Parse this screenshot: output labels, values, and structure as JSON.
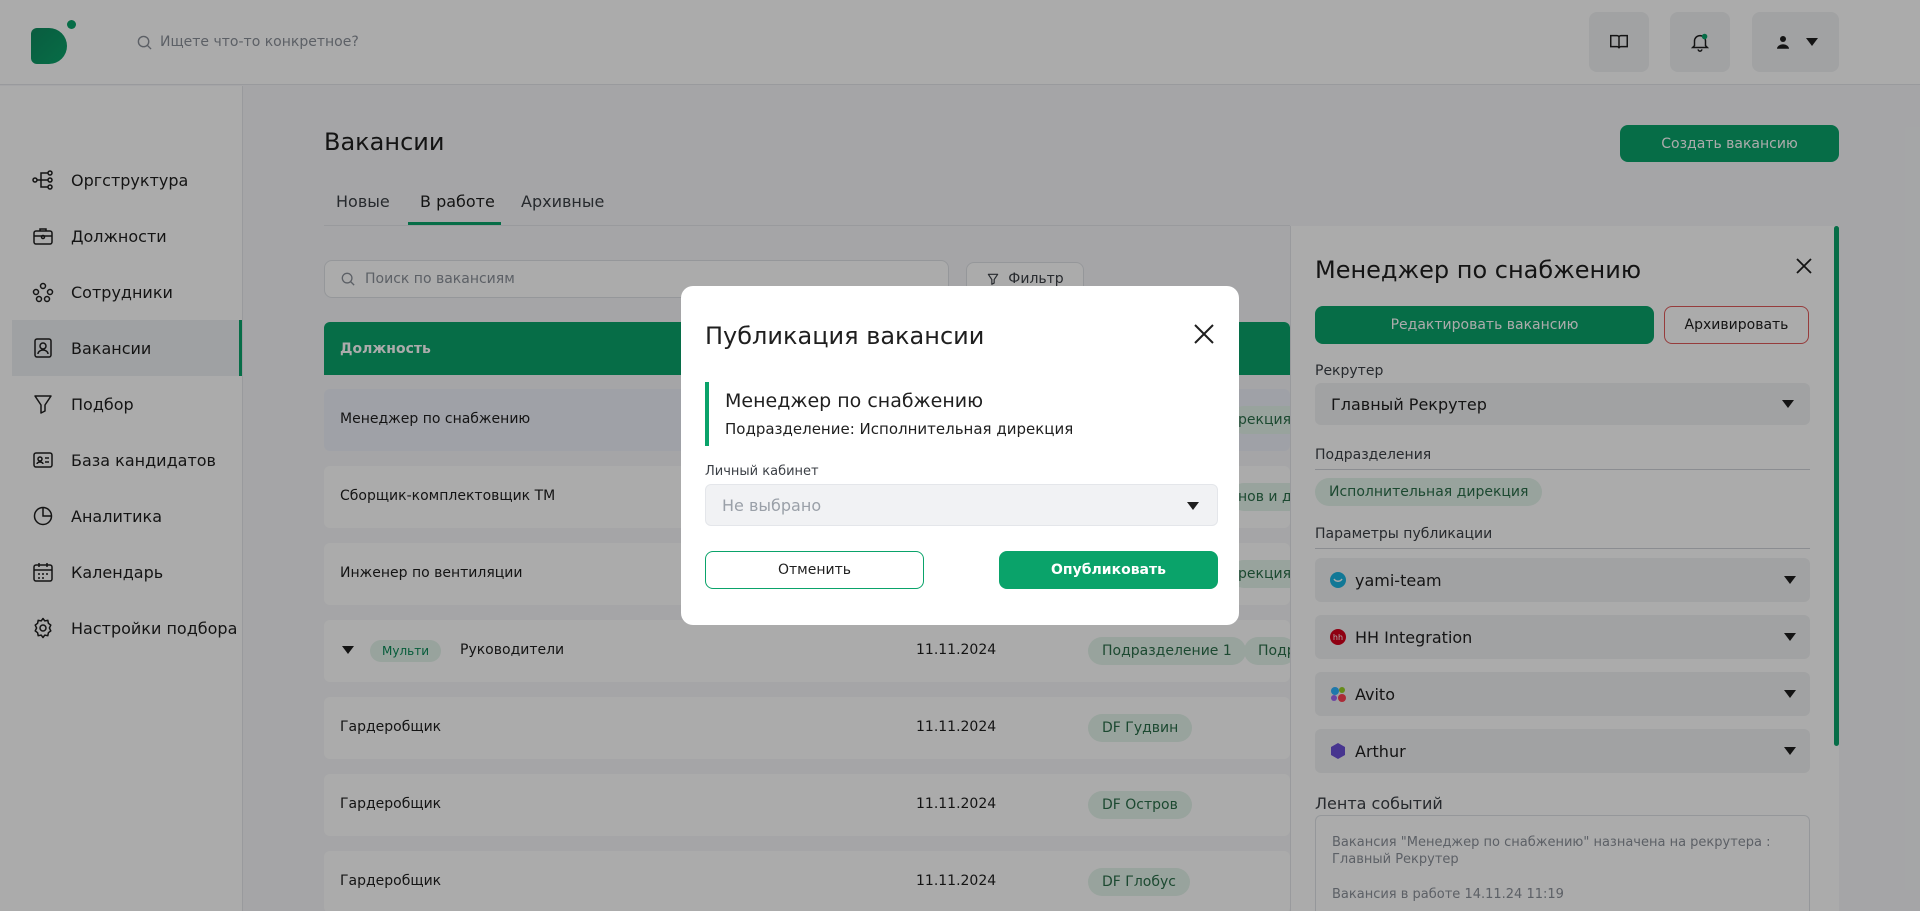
{
  "header": {
    "search_placeholder": "Ищете что-то конкретное?"
  },
  "sidebar": {
    "items": [
      {
        "label": "Оргструктура",
        "icon": "org-structure-icon"
      },
      {
        "label": "Должности",
        "icon": "briefcase-icon"
      },
      {
        "label": "Сотрудники",
        "icon": "people-icon"
      },
      {
        "label": "Вакансии",
        "icon": "vacancy-icon",
        "active": true
      },
      {
        "label": "Подбор",
        "icon": "funnel-icon"
      },
      {
        "label": "База кандидатов",
        "icon": "id-card-icon"
      },
      {
        "label": "Аналитика",
        "icon": "pie-chart-icon"
      },
      {
        "label": "Календарь",
        "icon": "calendar-icon"
      },
      {
        "label": "Настройки подбора",
        "icon": "gear-icon"
      }
    ]
  },
  "main": {
    "title": "Вакансии",
    "create_button": "Создать вакансию",
    "tabs": [
      {
        "label": "Новые"
      },
      {
        "label": "В работе",
        "active": true
      },
      {
        "label": "Архивные"
      }
    ],
    "search_placeholder": "Поиск по вакансиям",
    "filter_label": "Фильтр",
    "table": {
      "header_position": "Должность",
      "rows": [
        {
          "name": "Менеджер по снабжению",
          "date": "",
          "chips": [
            "рекция"
          ],
          "selected": true
        },
        {
          "name": "Сборщик-комплектовщик ТМ",
          "date": "",
          "chips": [
            "нов и до"
          ]
        },
        {
          "name": "Инженер по вентиляции",
          "date": "",
          "chips": [
            "рекция"
          ]
        },
        {
          "name": "Руководители",
          "multi": "Мульти",
          "date": "11.11.2024",
          "chips": [
            "Подразделение 1",
            "Подр"
          ]
        },
        {
          "name": "Гардеробщик",
          "date": "11.11.2024",
          "chips": [
            "DF Гудвин"
          ]
        },
        {
          "name": "Гардеробщик",
          "date": "11.11.2024",
          "chips": [
            "DF Остров"
          ]
        },
        {
          "name": "Гардеробщик",
          "date": "11.11.2024",
          "chips": [
            "DF Глобус"
          ]
        }
      ]
    }
  },
  "panel": {
    "title": "Менеджер по снабжению",
    "edit_button": "Редактировать вакансию",
    "archive_button": "Архивировать",
    "recruiter_label": "Рекрутер",
    "recruiter_value": "Главный Рекрутер",
    "divisions_label": "Подразделения",
    "division_chip": "Исполнительная дирекция",
    "publication_label": "Параметры публикации",
    "publications": [
      {
        "name": "yami-team",
        "icon": "yami-team-icon",
        "color": "#1ab3e0"
      },
      {
        "name": "HH Integration",
        "icon": "hh-icon",
        "color": "#d6001c"
      },
      {
        "name": "Avito",
        "icon": "avito-icon",
        "color": "#2fb3ff"
      },
      {
        "name": "Arthur",
        "icon": "arthur-icon",
        "color": "#6b4fd6"
      }
    ],
    "feed_label": "Лента событий",
    "feed": [
      "Вакансия \"Менеджер по снабжению\" назначена на рекрутера : Главный Рекрутер",
      "Вакансия в работе 14.11.24 11:19"
    ]
  },
  "modal": {
    "title": "Публикация вакансии",
    "vacancy_name": "Менеджер по снабжению",
    "division": "Подразделение: Исполнительная дирекция",
    "account_label": "Личный кабинет",
    "account_value": "Не выбрано",
    "cancel_button": "Отменить",
    "publish_button": "Опубликовать"
  },
  "colors": {
    "accent": "#0aa36a",
    "archive_border": "#e05a5a"
  }
}
